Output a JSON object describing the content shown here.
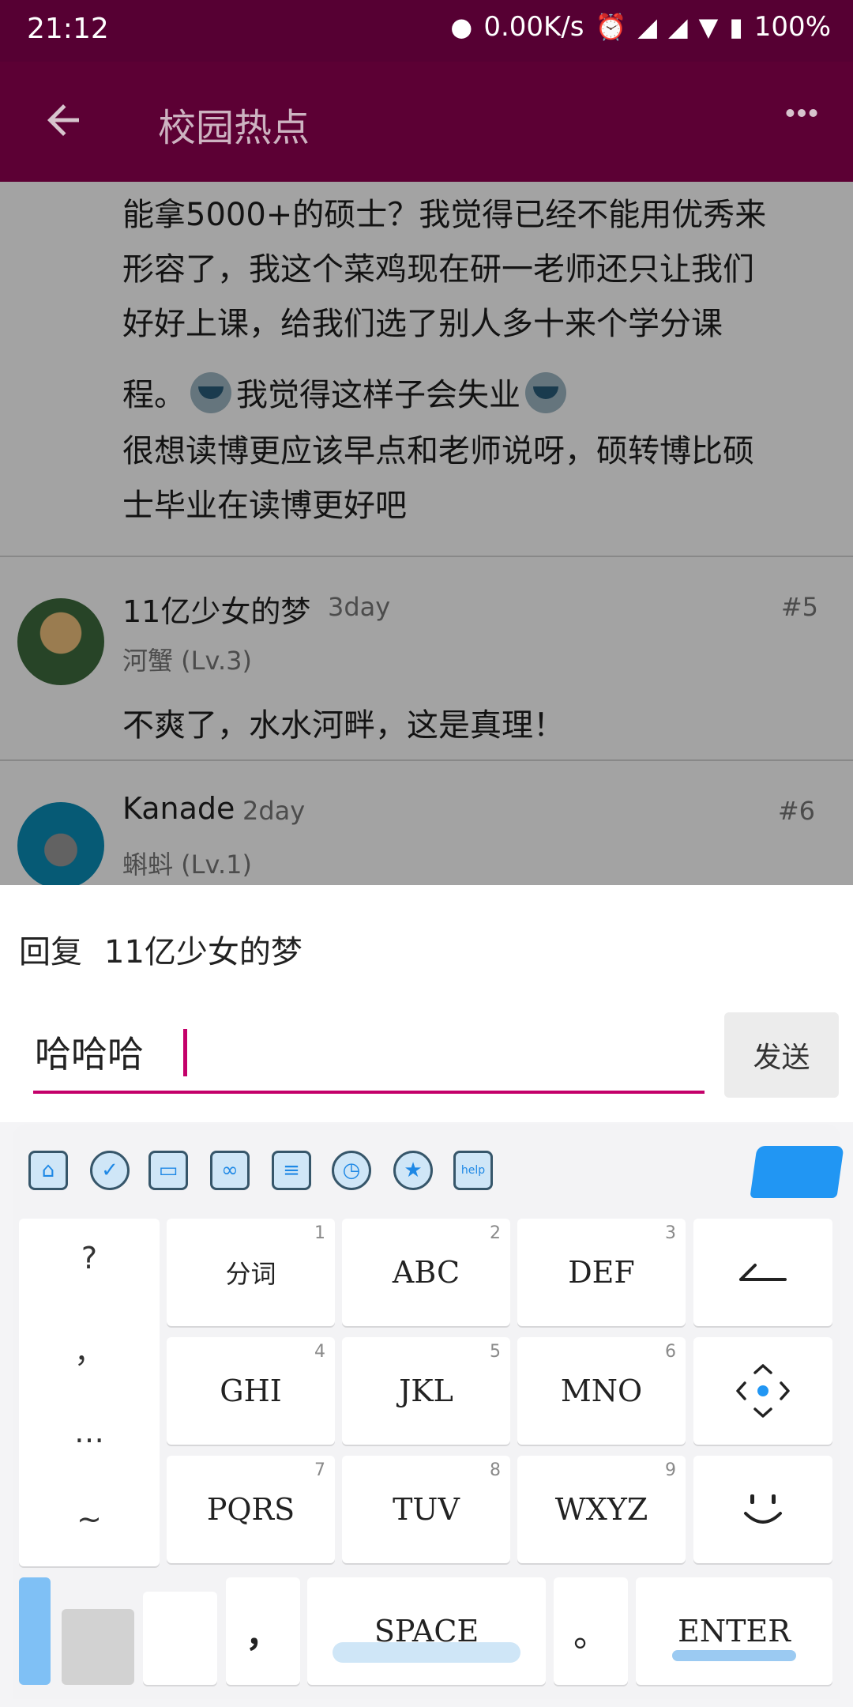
{
  "status_bar": {
    "time": "21:12",
    "speed": "0.00K/s",
    "battery": "100%",
    "icons": [
      "message-icon",
      "alarm-icon",
      "signal-icon",
      "signal-icon",
      "wifi-icon",
      "battery-icon"
    ]
  },
  "app_bar": {
    "back_icon": "arrow-left-icon",
    "title": "校园热点",
    "more_icon": "more-horizontal-icon"
  },
  "post": {
    "line1": "能拿5000+的硕士？我觉得已经不能用优秀来",
    "line2": "形容了，我这个菜鸡现在研一老师还只让我们",
    "line3": "好好上课，给我们选了别人多十来个学分课",
    "line4a": "程。",
    "line4b": "我觉得这样子会失业",
    "line5": "很想读博更应该早点和老师说呀，硕转博比硕",
    "line6": "士毕业在读博更好吧"
  },
  "replies": [
    {
      "username": "11亿少女的梦",
      "time": "3day",
      "floor": "#5",
      "rank": "河蟹 (Lv.3)",
      "text": "不爽了，水水河畔，这是真理！"
    },
    {
      "username": "Kanade",
      "time": "2day",
      "floor": "#6",
      "rank": "蝌蚪 (Lv.1)"
    }
  ],
  "reply_panel": {
    "prefix": "回复",
    "target": "11亿少女的梦",
    "input_value": "哈哈哈",
    "send_label": "发送"
  },
  "keyboard": {
    "toolbar_icons": [
      "home-icon",
      "check-icon",
      "keyboard-icon",
      "link-icon",
      "document-icon",
      "clock-icon",
      "star-icon",
      "help-icon"
    ],
    "help_label": "help",
    "symbols": [
      "?",
      "，",
      "…",
      "~"
    ],
    "keys": [
      {
        "label": "分词",
        "num": "1"
      },
      {
        "label": "ABC",
        "num": "2"
      },
      {
        "label": "DEF",
        "num": "3"
      },
      {
        "label": "GHI",
        "num": "4"
      },
      {
        "label": "JKL",
        "num": "5"
      },
      {
        "label": "MNO",
        "num": "6"
      },
      {
        "label": "PQRS",
        "num": "7"
      },
      {
        "label": "TUV",
        "num": "8"
      },
      {
        "label": "WXYZ",
        "num": "9"
      }
    ],
    "comma": "，",
    "space": "SPACE",
    "period": "。",
    "enter": "ENTER",
    "accent": "#2196f3"
  },
  "colors": {
    "app_bar": "#5c0034",
    "accent": "#c4006a"
  }
}
